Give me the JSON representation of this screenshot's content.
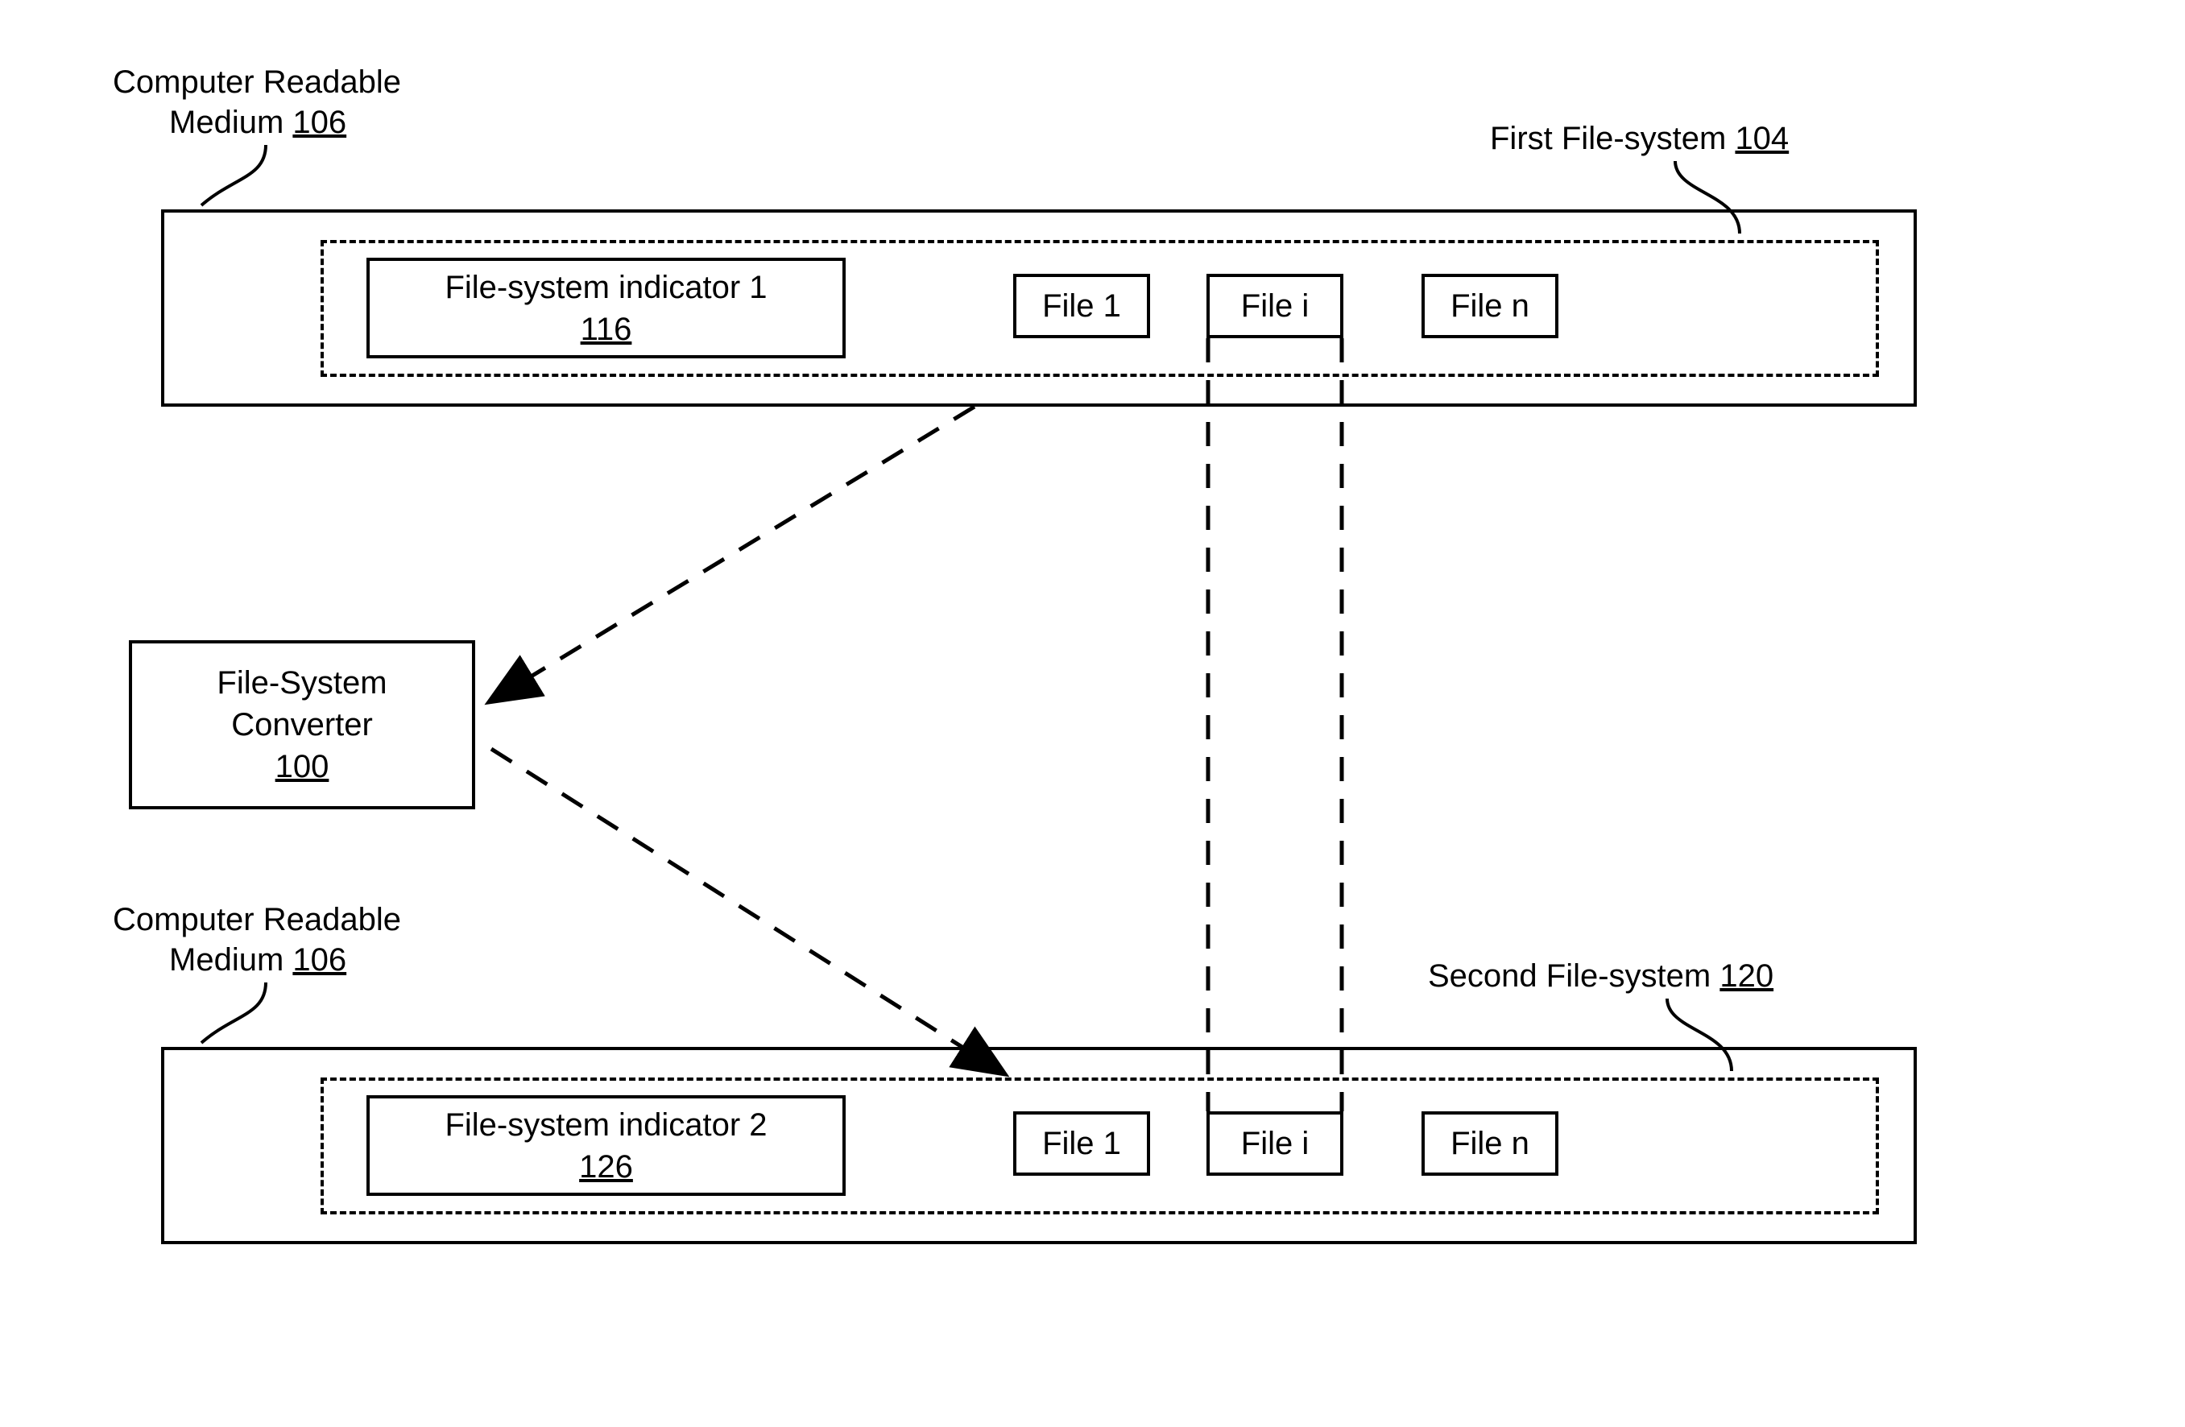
{
  "top": {
    "label_line1": "Computer Readable",
    "label_line2_text": "Medium ",
    "label_line2_num": "106",
    "fs_label_text": "First File-system ",
    "fs_label_num": "104",
    "indicator_line1": "File-system indicator 1",
    "indicator_num": "116",
    "file1": "File 1",
    "filei": "File i",
    "filen": "File n"
  },
  "converter": {
    "line1": "File-System",
    "line2": "Converter",
    "num": "100"
  },
  "bottom": {
    "label_line1": "Computer Readable",
    "label_line2_text": "Medium ",
    "label_line2_num": "106",
    "fs_label_text": "Second File-system ",
    "fs_label_num": "120",
    "indicator_line1": "File-system indicator 2",
    "indicator_num": "126",
    "file1": "File 1",
    "filei": "File i",
    "filen": "File n"
  }
}
